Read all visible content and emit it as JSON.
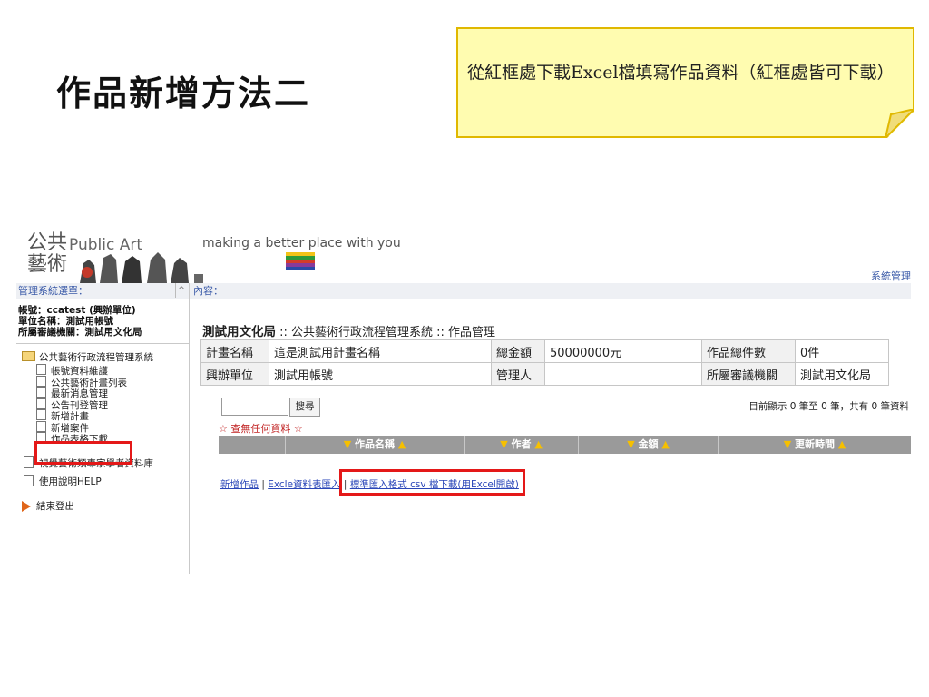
{
  "slide": {
    "title": "作品新增方法二",
    "note": "從紅框處下載Excel檔填寫作品資料（紅框處皆可下載）"
  },
  "banner": {
    "logo_cn_1": "公共",
    "logo_cn_2": "藝術",
    "logo_en": "Public Art",
    "tagline": "making a better place with you",
    "system_manage": "系統管理"
  },
  "sidebar": {
    "header": "管理系統選單：",
    "account": "帳號：ccatest (興辦單位)",
    "unit": "單位名稱：測試用帳號",
    "agency": "所屬審議機關：測試用文化局",
    "root": "公共藝術行政流程管理系統",
    "items": [
      "帳號資料維護",
      "公共藝術計畫列表",
      "最新消息管理",
      "公告刊登管理",
      "新增計畫",
      "新增案件",
      "作品表格下載"
    ],
    "extra": [
      "視覺藝術類專家學者資料庫",
      "使用說明HELP"
    ],
    "logout": "結束登出"
  },
  "main": {
    "header": "內容：",
    "crumb_bold": "測試用文化局",
    "crumb_rest": " :: 公共藝術行政流程管理系統 :: 作品管理",
    "info": {
      "row1": [
        "計畫名稱",
        "這是測試用計畫名稱",
        "總金額",
        "50000000元",
        "作品總件數",
        "0件"
      ],
      "row2": [
        "興辦單位",
        "測試用帳號",
        "管理人",
        "",
        "所屬審議機關",
        "測試用文化局"
      ]
    },
    "search_button": "搜尋",
    "status": "目前顯示 0 筆至 0 筆，共有 0 筆資料",
    "no_data": "☆ 查無任何資料 ☆",
    "columns": [
      "作品名稱",
      "作者",
      "金額",
      "更新時間"
    ],
    "link_add": "新增作品",
    "link_sep": " | ",
    "link_import": "Excle資料表匯入",
    "link_download": "標準匯入格式 csv 檔下載(用Excel開啟)"
  },
  "colors": {
    "red_highlight": "#e41818",
    "note_bg": "#fffcb0",
    "note_border": "#e0b800",
    "grid_header": "#9a9a9a",
    "link": "#2a46b8"
  }
}
